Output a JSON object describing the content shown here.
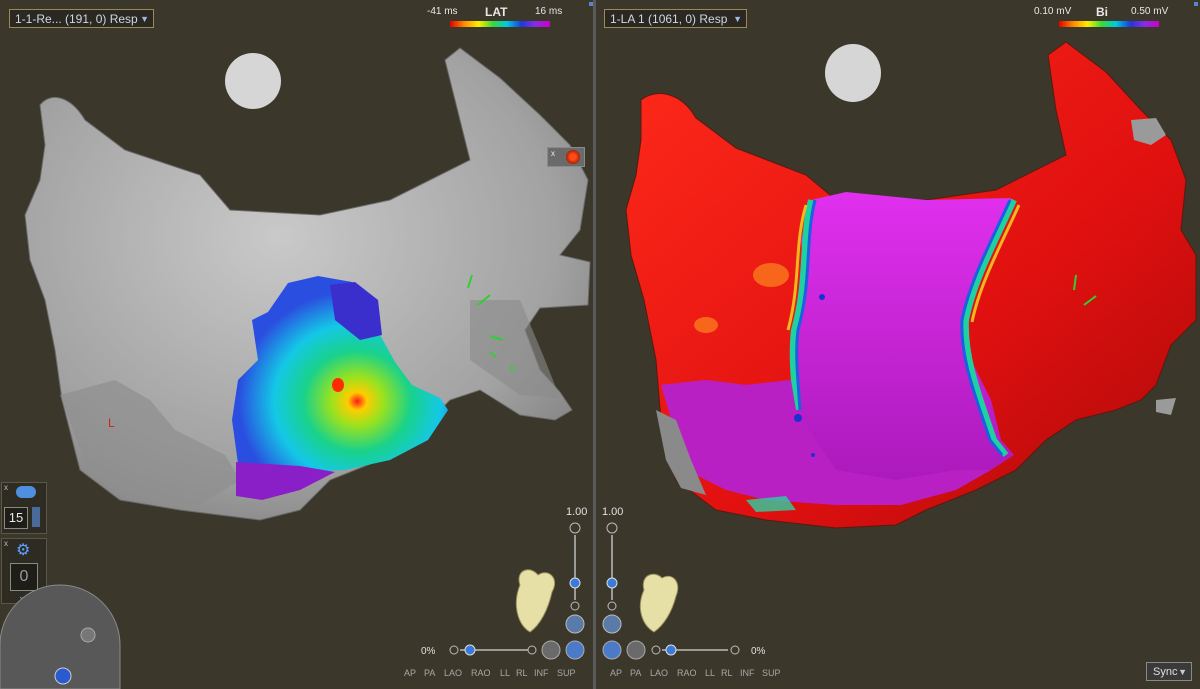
{
  "left_view": {
    "map_selector": "1-1-Re... (191, 0) Resp",
    "scale": {
      "min": "-41 ms",
      "title": "LAT",
      "max": "16 ms"
    },
    "zoom_value": "1.00",
    "rotation_pct": "0%",
    "view_buttons": [
      "AP",
      "PA",
      "LAO",
      "RAO",
      "LL",
      "RL",
      "INF",
      "SUP"
    ],
    "annotation_l": "L",
    "counter_value": "15",
    "timer_value": "0"
  },
  "right_view": {
    "map_selector": "1-LA 1 (1061, 0) Resp",
    "scale": {
      "min": "0.10 mV",
      "title": "Bi",
      "max": "0.50 mV"
    },
    "zoom_value": "1.00",
    "rotation_pct": "0%",
    "view_buttons": [
      "AP",
      "PA",
      "LAO",
      "RAO",
      "LL",
      "RL",
      "INF",
      "SUP"
    ],
    "sync_label": "Sync"
  },
  "colors": {
    "background": "#3b372b",
    "mesh_gray": "#a9a9a9",
    "low_voltage": "#cc22dd",
    "high_voltage": "#e01010"
  }
}
